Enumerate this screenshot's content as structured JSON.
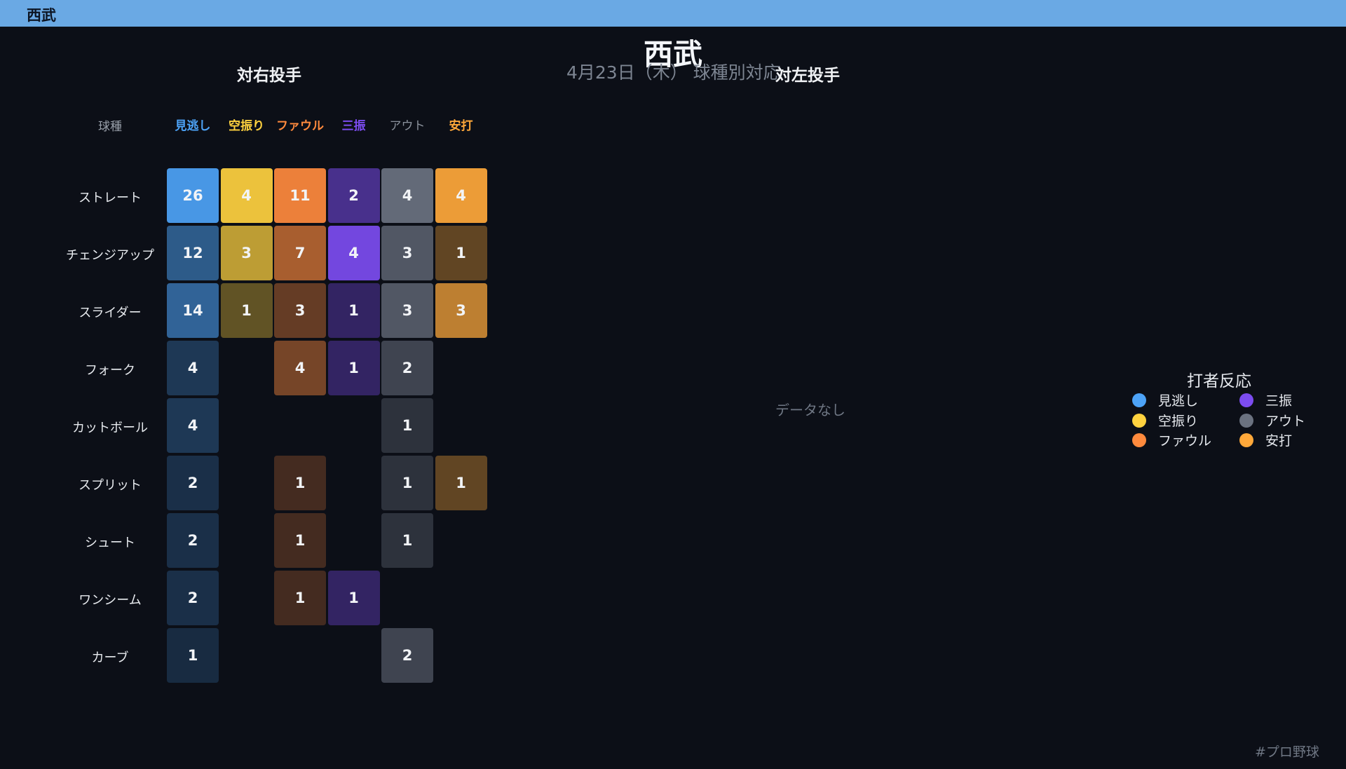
{
  "header": {
    "title": "西武"
  },
  "title": "西武",
  "subtitle": "4月23日（木） 球種別対応",
  "left_panel_title": "対右投手",
  "right_panel_title": "対左投手",
  "row_header": "球種",
  "no_data": "データなし",
  "legend": {
    "title": "打者反応",
    "items": [
      {
        "label": "見逃し",
        "color": "#4da3f7"
      },
      {
        "label": "三振",
        "color": "#7c4cf0"
      },
      {
        "label": "空振り",
        "color": "#ffd23f"
      },
      {
        "label": "アウト",
        "color": "#6b7280"
      },
      {
        "label": "ファウル",
        "color": "#ff8a3d"
      },
      {
        "label": "安打",
        "color": "#ffa83a"
      }
    ]
  },
  "hashtag": "#プロ野球",
  "chart_data": {
    "type": "heatmap",
    "title": "西武",
    "subtitle": "4月23日（木） 球種別対応",
    "panels": [
      {
        "title": "対右投手",
        "row_header": "球種",
        "columns": [
          {
            "label": "見逃し",
            "color": "#4da3f7"
          },
          {
            "label": "空振り",
            "color": "#ffd23f"
          },
          {
            "label": "ファウル",
            "color": "#ff8a3d"
          },
          {
            "label": "三振",
            "color": "#7c4cf0"
          },
          {
            "label": "アウト",
            "color": "#6b7280"
          },
          {
            "label": "安打",
            "color": "#ffa83a"
          }
        ],
        "rows": [
          "ストレート",
          "チェンジアップ",
          "スライダー",
          "フォーク",
          "カットボール",
          "スプリット",
          "シュート",
          "ワンシーム",
          "カーブ"
        ],
        "values": [
          [
            26,
            4,
            11,
            2,
            4,
            4
          ],
          [
            12,
            3,
            7,
            4,
            3,
            1
          ],
          [
            14,
            1,
            3,
            1,
            3,
            3
          ],
          [
            4,
            0,
            4,
            1,
            2,
            0
          ],
          [
            4,
            0,
            0,
            0,
            1,
            0
          ],
          [
            2,
            0,
            1,
            0,
            1,
            1
          ],
          [
            2,
            0,
            1,
            0,
            1,
            0
          ],
          [
            2,
            0,
            1,
            1,
            0,
            0
          ],
          [
            1,
            0,
            0,
            0,
            2,
            0
          ]
        ]
      },
      {
        "title": "対左投手",
        "empty_text": "データなし"
      }
    ]
  }
}
